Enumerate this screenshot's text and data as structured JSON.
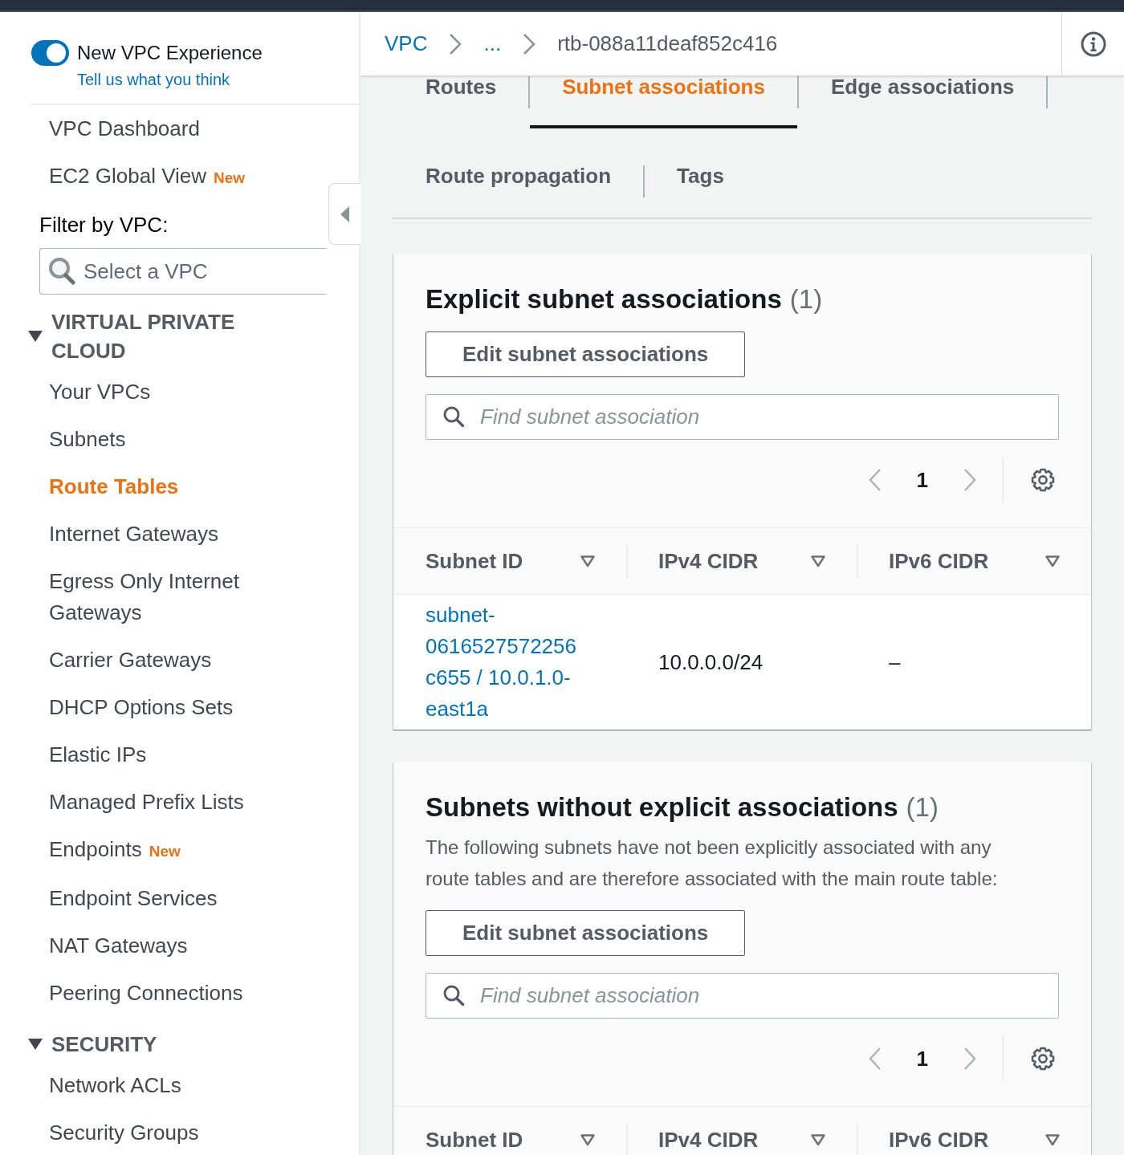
{
  "sidebar": {
    "toggle": {
      "label": "New VPC Experience",
      "on": true
    },
    "feedback_link": "Tell us what you think",
    "items": [
      {
        "label": "VPC Dashboard",
        "selected": false
      },
      {
        "label": "EC2 Global View",
        "badge": "New",
        "selected": false
      }
    ],
    "filter": {
      "label": "Filter by VPC:",
      "placeholder": "Select a VPC"
    },
    "sections": [
      {
        "title": "VIRTUAL PRIVATE CLOUD",
        "expanded": true,
        "items": [
          {
            "label": "Your VPCs",
            "selected": false
          },
          {
            "label": "Subnets",
            "selected": false
          },
          {
            "label": "Route Tables",
            "selected": true
          },
          {
            "label": "Internet Gateways",
            "selected": false
          },
          {
            "label": "Egress Only Internet Gateways",
            "selected": false
          },
          {
            "label": "Carrier Gateways",
            "selected": false
          },
          {
            "label": "DHCP Options Sets",
            "selected": false
          },
          {
            "label": "Elastic IPs",
            "selected": false
          },
          {
            "label": "Managed Prefix Lists",
            "selected": false
          },
          {
            "label": "Endpoints",
            "badge": "New",
            "selected": false
          },
          {
            "label": "Endpoint Services",
            "selected": false
          },
          {
            "label": "NAT Gateways",
            "selected": false
          },
          {
            "label": "Peering Connections",
            "selected": false
          }
        ]
      },
      {
        "title": "SECURITY",
        "expanded": true,
        "items": [
          {
            "label": "Network ACLs",
            "selected": false
          },
          {
            "label": "Security Groups",
            "selected": false
          }
        ]
      }
    ]
  },
  "breadcrumb": [
    {
      "label": "VPC",
      "kind": "link"
    },
    {
      "label": "...",
      "kind": "link"
    },
    {
      "label": "rtb-088a11deaf852c416",
      "kind": "current"
    }
  ],
  "tabs": [
    {
      "label": "Routes",
      "selected": false
    },
    {
      "label": "Subnet associations",
      "selected": true
    },
    {
      "label": "Edge associations",
      "selected": false
    },
    {
      "label": "Route propagation",
      "selected": false
    },
    {
      "label": "Tags",
      "selected": false
    }
  ],
  "cards": [
    {
      "title": "Explicit subnet associations",
      "count": "(1)",
      "button": "Edit subnet associations",
      "search": {
        "placeholder": "Find subnet association"
      },
      "pagination": {
        "prev_disabled": true,
        "page": "1",
        "next_disabled": true
      },
      "table": {
        "columns": [
          "Subnet ID",
          "IPv4 CIDR",
          "IPv6 CIDR"
        ],
        "rows": [
          {
            "cells": [
              {
                "text": "subnet-0616527572256c655 / 10.0.1.0-east1a",
                "kind": "link"
              },
              {
                "text": "10.0.0.0/24",
                "kind": "text"
              },
              {
                "text": "–",
                "kind": "text"
              }
            ]
          }
        ]
      }
    },
    {
      "title": "Subnets without explicit associations",
      "count": "(1)",
      "description": "The following subnets have not been explicitly associated with any route tables and are therefore associated with the main route table:",
      "button": "Edit subnet associations",
      "search": {
        "placeholder": "Find subnet association"
      },
      "pagination": {
        "prev_disabled": true,
        "page": "1",
        "next_disabled": true
      },
      "table": {
        "columns": [
          "Subnet ID",
          "IPv4 CIDR",
          "IPv6 CIDR"
        ]
      }
    }
  ]
}
